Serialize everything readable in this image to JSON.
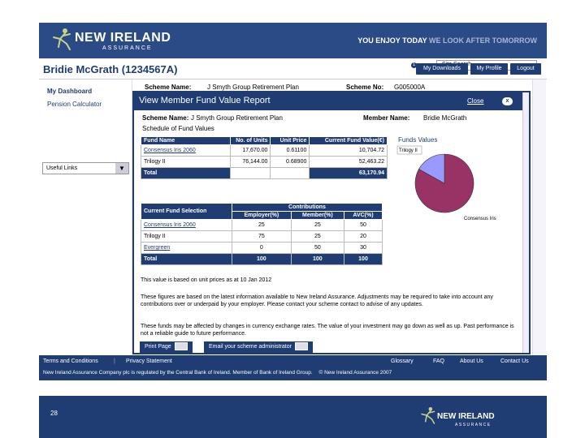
{
  "header": {
    "brand_name": "NEW IRELAND",
    "brand_sub": "ASSURANCE",
    "tagline_bold": "YOU ENJOY TODAY",
    "tagline_dim": "WE LOOK AFTER TOMORROW"
  },
  "titlebar": {
    "member_title": "Bridie McGrath (1234567A)",
    "search_placeholder": "Site Search",
    "badge": "1",
    "nav": [
      "My Downloads",
      "My Profile",
      "Logout"
    ]
  },
  "sidebar": {
    "dashboard": "My Dashboard",
    "pension_calc": "Pension Calculator",
    "useful_links": "Useful Links"
  },
  "background": {
    "scheme_label": "Scheme Name:",
    "scheme_value": "J Smyth Group Retirement Plan",
    "scheme_no_label": "Scheme No:",
    "scheme_no_value": "G005000A"
  },
  "modal": {
    "title": "View Member Fund Value Report",
    "close": "Close",
    "close_x": "x",
    "scheme_label": "Scheme Name:",
    "scheme_value": "J Smyth Group Retirement Plan",
    "member_label": "Member Name:",
    "member_value": "Bridie McGrath",
    "schedule_title": "Schedule of Fund Values",
    "values_table": {
      "headers": [
        "Fund Name",
        "No. of Units",
        "Unit Price",
        "Current Fund Value(€)"
      ],
      "rows": [
        [
          "Consensus Iris 2060",
          "17,670.00",
          "0.61100",
          "10,704.72"
        ],
        [
          "Trilogy II",
          "76,144.00",
          "0.68900",
          "52,463.22"
        ]
      ],
      "total_label": "Total",
      "total_value": "63,170.94"
    },
    "selection_table": {
      "contrib_header": "Contributions",
      "headers": [
        "Current Fund Selection",
        "Employer(%)",
        "Member(%)",
        "AVC(%)"
      ],
      "rows": [
        [
          "Consensus Iris 2060",
          "25",
          "25",
          "50"
        ],
        [
          "Trilogy II",
          "75",
          "25",
          "20"
        ],
        [
          "Evergreen",
          "0",
          "50",
          "30"
        ]
      ],
      "total_label": "Total",
      "totals": [
        "100",
        "100",
        "100"
      ]
    },
    "unit_price_note": "This value is based on unit prices as at 10 Jan 2012",
    "para1": "These figures are based on the latest information available to New Ireland Assurance. Adjustments may be required to take into account any contributions over or underpaid by your employer. Please contact your scheme contact to advise of any updates.",
    "para2": "These funds may be affected by changes in currency exchange rates. The value of your investment may go down as well as up. Past performance is not a reliable guide to future performance.",
    "print_btn": "Print Page",
    "email_btn": "Email your scheme administrator"
  },
  "chart_data": {
    "type": "pie",
    "title": "Funds Values",
    "categories": [
      "Trilogy II",
      "Consensus Iris"
    ],
    "values": [
      52463.22,
      10704.72
    ],
    "colors": [
      "#993366",
      "#9999ff"
    ]
  },
  "footer": {
    "left_links": [
      "Terms and Conditions",
      "Privacy Statement"
    ],
    "right_links": [
      "Glossary",
      "FAQ",
      "About Us",
      "Contact Us"
    ],
    "regulation": "New Ireland Assurance Company plc is regulated by the Central Bank of Ireland. Member of Bank of Ireland Group.",
    "copyright": "© New Ireland Assurance 2007"
  },
  "slide": {
    "number": "28",
    "brand_name": "NEW IRELAND",
    "brand_sub": "ASSURANCE"
  }
}
